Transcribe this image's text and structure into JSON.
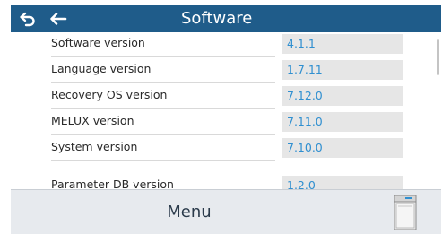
{
  "header": {
    "title": "Software",
    "undo_icon": "undo-icon",
    "back_icon": "arrow-left-icon",
    "background_color": "#1f5c8a"
  },
  "rows": [
    {
      "label": "Software version",
      "value": "4.1.1"
    },
    {
      "label": "Language version",
      "value": "1.7.11"
    },
    {
      "label": "Recovery OS version",
      "value": "7.12.0"
    },
    {
      "label": "MELUX version",
      "value": "7.11.0"
    },
    {
      "label": "System version",
      "value": "7.10.0"
    },
    {
      "label": "Parameter DB version",
      "value": "1.2.0"
    }
  ],
  "footer": {
    "menu_label": "Menu",
    "device_icon": "device-icon"
  },
  "colors": {
    "value_text": "#2f8fd0",
    "value_bg": "#e6e6e6",
    "footer_bg": "#e7eaee"
  }
}
